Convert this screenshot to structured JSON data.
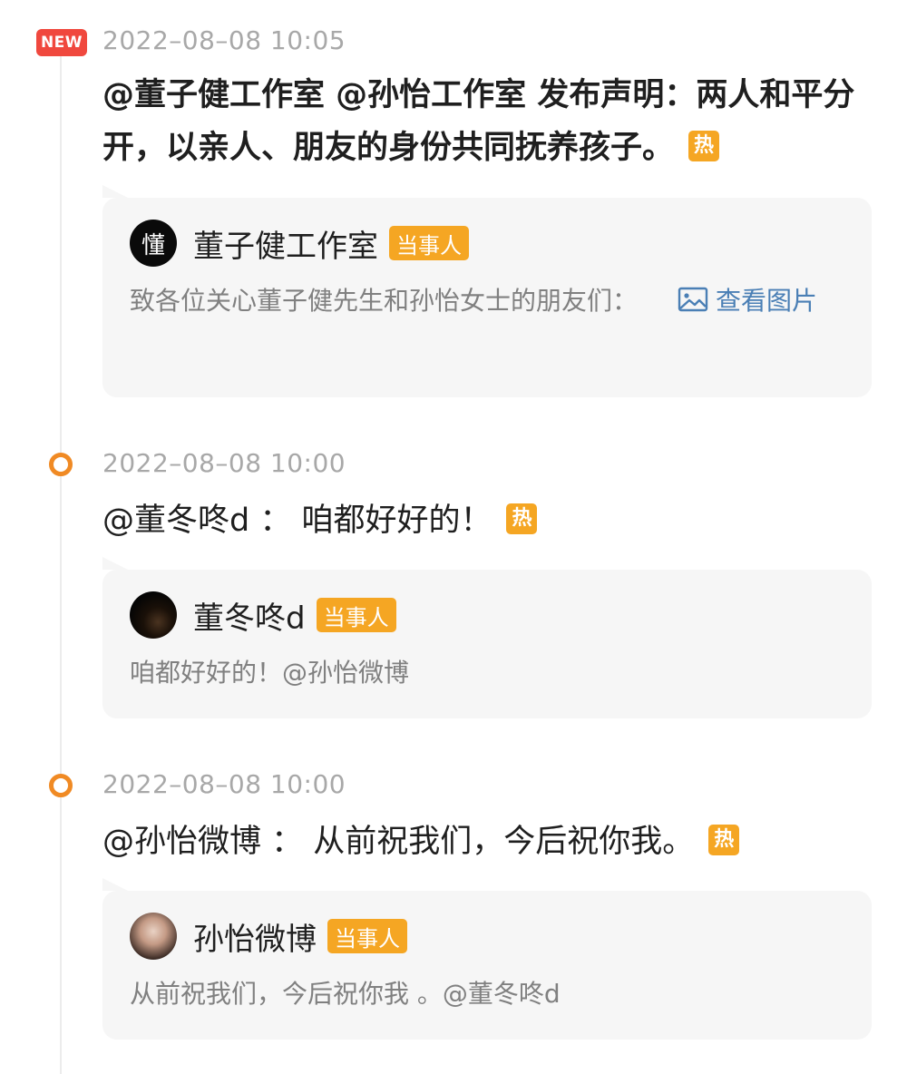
{
  "entries": [
    {
      "badge": "NEW",
      "time": "2022–08–08 10:05",
      "headline": "@董子健工作室 @孙怡工作室 发布声明：两人和平分开，以亲人、朋友的身份共同抚养孩子。",
      "hot": "热",
      "card": {
        "avatar_text": "懂",
        "name": "董子健工作室",
        "tag": "当事人",
        "text": "致各位关心董子健先生和孙怡女士的朋友们：",
        "link_label": "查看图片",
        "link_icon": "image-icon"
      }
    },
    {
      "time": "2022–08–08 10:00",
      "headline": "@董冬咚d ： 咱都好好的！",
      "hot": "热",
      "card": {
        "name": "董冬咚d",
        "tag": "当事人",
        "text": "咱都好好的！@孙怡微博"
      }
    },
    {
      "time": "2022–08–08 10:00",
      "headline": "@孙怡微博 ： 从前祝我们，今后祝你我。",
      "hot": "热",
      "card": {
        "name": "孙怡微博",
        "tag": "当事人",
        "text": "从前祝我们，今后祝你我 。@董冬咚d"
      }
    }
  ],
  "colors": {
    "new_badge": "#f0483e",
    "hot_badge": "#f5a623",
    "timeline_dot": "#f08a24",
    "link": "#4a7fb5",
    "card_bg": "#f6f6f6"
  }
}
